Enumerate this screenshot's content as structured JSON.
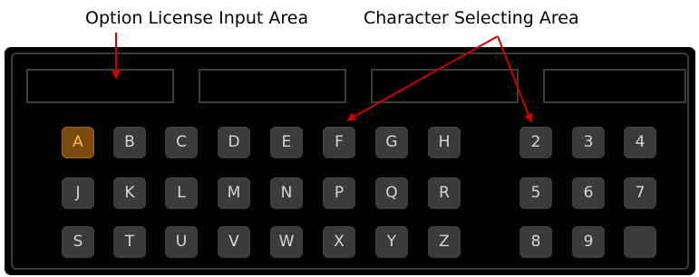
{
  "callouts": {
    "left": "Option License Input Area",
    "right": "Character Selecting Area"
  },
  "license_fields": [
    "",
    "",
    "",
    ""
  ],
  "letters": {
    "row1": [
      "A",
      "B",
      "C",
      "D",
      "E",
      "F",
      "G",
      "H"
    ],
    "row2": [
      "J",
      "K",
      "L",
      "M",
      "N",
      "P",
      "Q",
      "R"
    ],
    "row3": [
      "S",
      "T",
      "U",
      "V",
      "W",
      "X",
      "Y",
      "Z"
    ]
  },
  "digits": {
    "row1": [
      "2",
      "3",
      "4"
    ],
    "row2": [
      "5",
      "6",
      "7"
    ],
    "row3": [
      "8",
      "9",
      ""
    ]
  },
  "selected_key": "A",
  "colors": {
    "panel_bg": "#000000",
    "key_bg": "#3b3b3b",
    "key_text": "#d6d6d6",
    "selected_bg": "#7a4a10",
    "selected_text": "#ffb84a",
    "arrow": "#cc0000"
  }
}
